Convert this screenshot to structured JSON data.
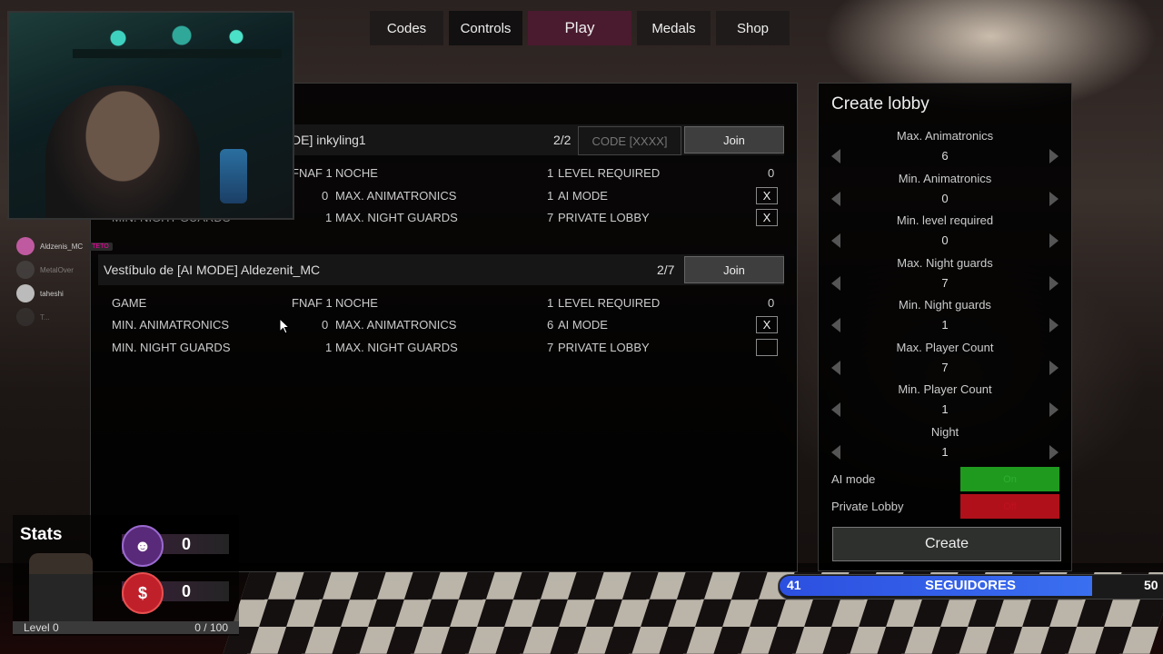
{
  "nav": {
    "codes": "Codes",
    "controls": "Controls",
    "play": "Play",
    "medals": "Medals",
    "shop": "Shop"
  },
  "chat": {
    "rows": [
      {
        "user": "Aldzenis_MC",
        "badge": "TETO"
      },
      {
        "user": "MetalOver"
      },
      {
        "user": "taheshi"
      },
      {
        "user": "T..."
      }
    ]
  },
  "lobbies": [
    {
      "title": "DE] inkyling1",
      "count": "2/2",
      "code_placeholder": "CODE [XXXX]",
      "join": "Join",
      "rows": [
        {
          "l1": "",
          "v1": "FNAF 1",
          "l2": "NOCHE",
          "v2": "1",
          "l3": "LEVEL REQUIRED",
          "v3": "0",
          "check": ""
        },
        {
          "l1": "",
          "v1": "0",
          "l2": "MAX. ANIMATRONICS",
          "v2": "1",
          "l3": "AI MODE",
          "check": "X"
        },
        {
          "l1": "MIN. NIGHT GUARDS",
          "v1": "1",
          "l2": "MAX. NIGHT GUARDS",
          "v2": "7",
          "l3": "PRIVATE LOBBY",
          "check": "X"
        }
      ]
    },
    {
      "title": "Vestíbulo de [AI MODE] Aldezenit_MC",
      "count": "2/7",
      "join": "Join",
      "rows": [
        {
          "l1": "GAME",
          "v1": "FNAF 1",
          "l2": "NOCHE",
          "v2": "1",
          "l3": "LEVEL REQUIRED",
          "v3": "0"
        },
        {
          "l1": "MIN. ANIMATRONICS",
          "v1": "0",
          "l2": "MAX. ANIMATRONICS",
          "v2": "6",
          "l3": "AI MODE",
          "check": "X"
        },
        {
          "l1": "MIN. NIGHT GUARDS",
          "v1": "1",
          "l2": "MAX. NIGHT GUARDS",
          "v2": "7",
          "l3": "PRIVATE LOBBY",
          "check": ""
        }
      ]
    }
  ],
  "create": {
    "title": "Create lobby",
    "settings": [
      {
        "label": "Max. Animatronics",
        "value": "6"
      },
      {
        "label": "Min. Animatronics",
        "value": "0"
      },
      {
        "label": "Min. level required",
        "value": "0"
      },
      {
        "label": "Max. Night guards",
        "value": "7"
      },
      {
        "label": "Min. Night guards",
        "value": "1"
      },
      {
        "label": "Max. Player Count",
        "value": "7"
      },
      {
        "label": "Min. Player Count",
        "value": "1"
      },
      {
        "label": "Night",
        "value": "1"
      }
    ],
    "ai_mode_label": "AI mode",
    "ai_mode_value": "On",
    "ai_mode_color": "#1f9a1f",
    "private_label": "Private Lobby",
    "private_value": "Off",
    "private_color": "#b0101a",
    "create_button": "Create"
  },
  "stats": {
    "title": "Stats",
    "animatronic_count": "0",
    "money": "0",
    "money_icon": "$",
    "level": "Level 0",
    "xp": "0 / 100"
  },
  "followers": {
    "current": "41",
    "label": "SEGUIDORES",
    "goal": "50",
    "progress": 0.82
  }
}
